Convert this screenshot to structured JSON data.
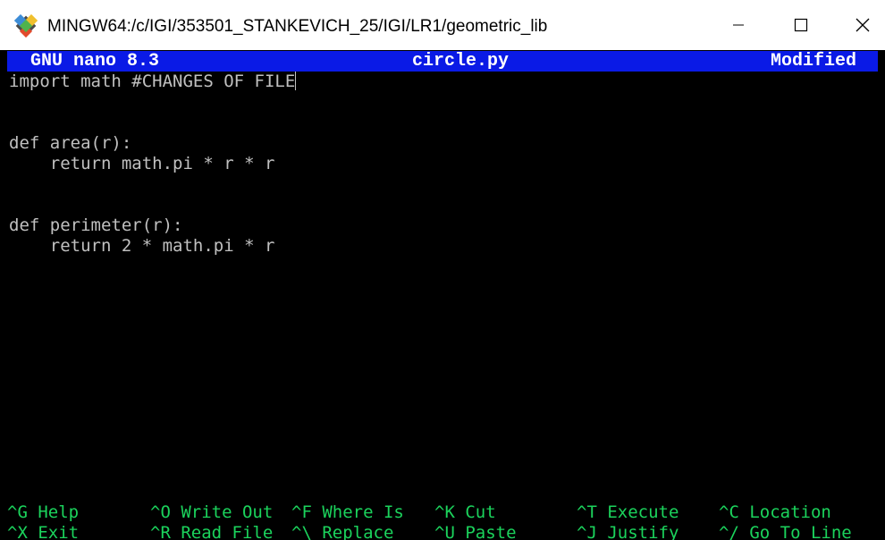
{
  "window": {
    "title": "MINGW64:/c/IGI/353501_STANKEVICH_25/IGI/LR1/geometric_lib",
    "colors": {
      "titlebar_bg": "#ffffff",
      "terminal_bg": "#000000",
      "nano_header_bg": "#0a1ae6",
      "text": "#c0c0c0",
      "shortcut_text": "#1bd35c"
    },
    "icons": [
      "git-bash-icon",
      "minimize-icon",
      "maximize-icon",
      "close-icon"
    ]
  },
  "nano": {
    "version": "GNU nano 8.3",
    "filename": "circle.py",
    "status": "Modified"
  },
  "editor": {
    "lines": [
      "import math #CHANGES OF FILE",
      "",
      "",
      "def area(r):",
      "    return math.pi * r * r",
      "",
      "",
      "def perimeter(r):",
      "    return 2 * math.pi * r"
    ]
  },
  "shortcuts": {
    "row1": [
      {
        "key": "^G",
        "label": "Help"
      },
      {
        "key": "^O",
        "label": "Write Out"
      },
      {
        "key": "^F",
        "label": "Where Is"
      },
      {
        "key": "^K",
        "label": "Cut"
      },
      {
        "key": "^T",
        "label": "Execute"
      },
      {
        "key": "^C",
        "label": "Location"
      }
    ],
    "row2": [
      {
        "key": "^X",
        "label": "Exit"
      },
      {
        "key": "^R",
        "label": "Read File"
      },
      {
        "key": "^\\",
        "label": "Replace"
      },
      {
        "key": "^U",
        "label": "Paste"
      },
      {
        "key": "^J",
        "label": "Justify"
      },
      {
        "key": "^/",
        "label": "Go To Line"
      }
    ]
  }
}
